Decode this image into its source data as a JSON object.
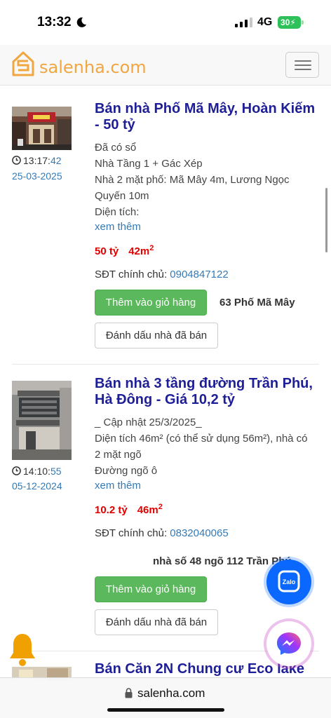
{
  "status_bar": {
    "time": "13:32",
    "network": "4G",
    "battery": "30"
  },
  "header": {
    "logo_text": "salenha.com"
  },
  "listings": [
    {
      "title": "Bán nhà Phố Mã Mây, Hoàn Kiếm - 50 tỷ",
      "time_main": "13:17:",
      "time_sec": "42",
      "date": "25-03-2025",
      "desc_lines": [
        "Đã có sổ",
        "Nhà Tầng 1 + Gác Xép",
        "Nhà 2 mặt phố: Mã Mây 4m, Lương Ngọc Quyến 10m",
        "Diện tích:"
      ],
      "more": "xem thêm",
      "price": "50 tỷ",
      "area": "42m",
      "area_sup": "2",
      "phone_label": "SĐT chính chủ: ",
      "phone": "0904847122",
      "cart_button": "Thêm vào giỏ hàng",
      "address": "63 Phố Mã Mây",
      "sold_button": "Đánh dấu nhà đã bán"
    },
    {
      "title": "Bán nhà 3 tầng đường Trần Phú, Hà Đông - Giá 10,2 tỷ",
      "time_main": "14:10:",
      "time_sec": "55",
      "date": "05-12-2024",
      "desc_lines": [
        "_ Cập nhật 25/3/2025_",
        "Diện tích 46m²  (có thể sử dụng 56m²), nhà có 2 mặt ngõ",
        "Đường ngõ ô"
      ],
      "more": "xem thêm",
      "price": "10.2 tỷ",
      "area": "46m",
      "area_sup": "2",
      "phone_label": "SĐT chính chủ: ",
      "phone": "0832040065",
      "cart_button": "Thêm vào giỏ hàng",
      "address": "nhà số 48 ngõ 112 Trần Phú",
      "sold_button": "Đánh dấu nhà đã bán"
    },
    {
      "title": "Bán Căn 2N Chung cư Eco lake"
    }
  ],
  "browser": {
    "url": "salenha.com"
  },
  "colors": {
    "brand": "#f0a742",
    "title": "#1e1e96",
    "price": "#e00000",
    "link": "#337ab7",
    "cart": "#5cb85c"
  }
}
